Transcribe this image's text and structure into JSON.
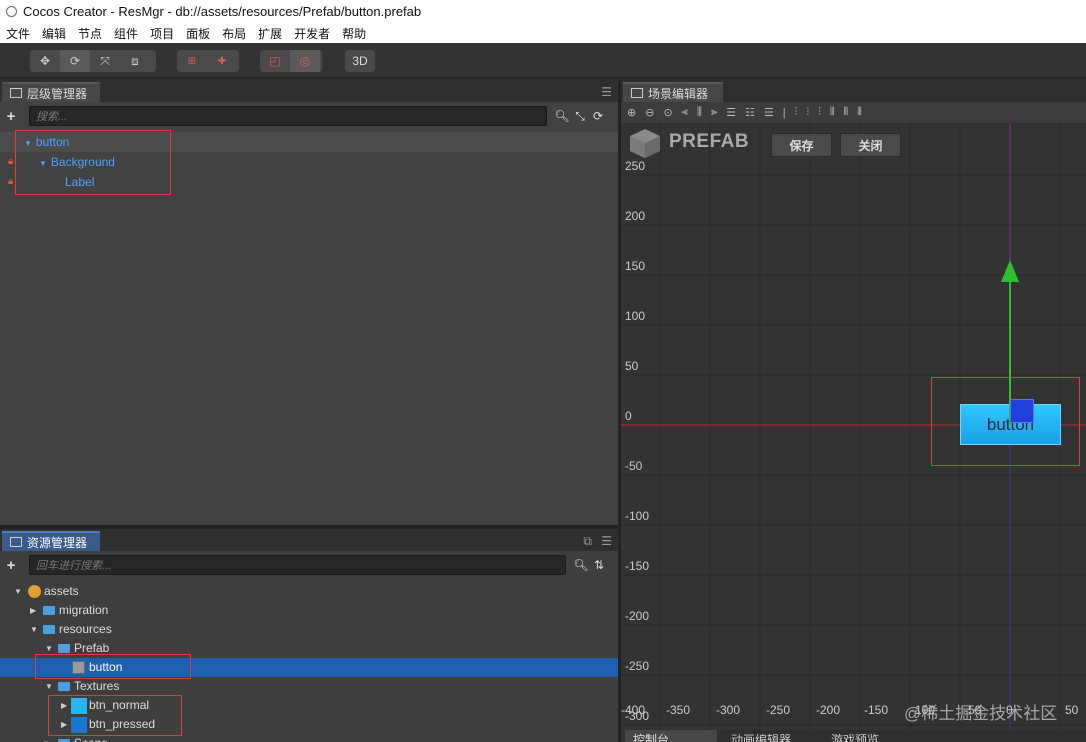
{
  "window": {
    "title": "Cocos Creator - ResMgr - db://assets/resources/Prefab/button.prefab"
  },
  "menu": [
    "文件",
    "编辑",
    "节点",
    "组件",
    "项目",
    "面板",
    "布局",
    "扩展",
    "开发者",
    "帮助"
  ],
  "toolbar": {
    "btn3d": "3D"
  },
  "hierarchy": {
    "tab": "层级管理器",
    "search_placeholder": "搜索...",
    "nodes": [
      {
        "label": "button",
        "expanded": true,
        "locked": false
      },
      {
        "label": "Background",
        "expanded": true,
        "locked": true
      },
      {
        "label": "Label",
        "expanded": false,
        "locked": true
      }
    ]
  },
  "assets": {
    "tab": "资源管理器",
    "search_placeholder": "回车进行搜索...",
    "items": [
      {
        "label": "assets",
        "icon": "db-icon",
        "expanded": true
      },
      {
        "label": "migration",
        "icon": "folder-icon",
        "expanded": false
      },
      {
        "label": "resources",
        "icon": "folder-icon",
        "expanded": true
      },
      {
        "label": "Prefab",
        "icon": "folder-icon",
        "expanded": true
      },
      {
        "label": "button",
        "icon": "prefab-icon",
        "selected": true
      },
      {
        "label": "Textures",
        "icon": "folder-icon",
        "expanded": true
      },
      {
        "label": "btn_normal",
        "icon": "texture-icon",
        "expanded": false
      },
      {
        "label": "btn_pressed",
        "icon": "texture-icon",
        "expanded": false
      },
      {
        "label": "Scene",
        "icon": "folder-icon",
        "expanded": false
      }
    ]
  },
  "scene": {
    "tab": "场景编辑器",
    "prefab_label": "PREFAB",
    "save_label": "保存",
    "close_label": "关闭",
    "y_ticks": [
      "250",
      "200",
      "150",
      "100",
      "50",
      "0",
      "-50",
      "-100",
      "-150",
      "-200",
      "-250",
      "-300"
    ],
    "x_ticks": [
      "-400",
      "-350",
      "-300",
      "-250",
      "-200",
      "-150",
      "-100",
      "-50",
      "0",
      "50"
    ],
    "node_label": "button",
    "watermark": "@稀土掘金技术社区"
  },
  "bottom_tabs": [
    "控制台",
    "动画编辑器",
    "游戏预览"
  ],
  "colors": {
    "accent": "#4aa3ff",
    "selection": "#1e5fb0",
    "annotation": "#e23b3b",
    "button_fill": "#21b3f5"
  }
}
